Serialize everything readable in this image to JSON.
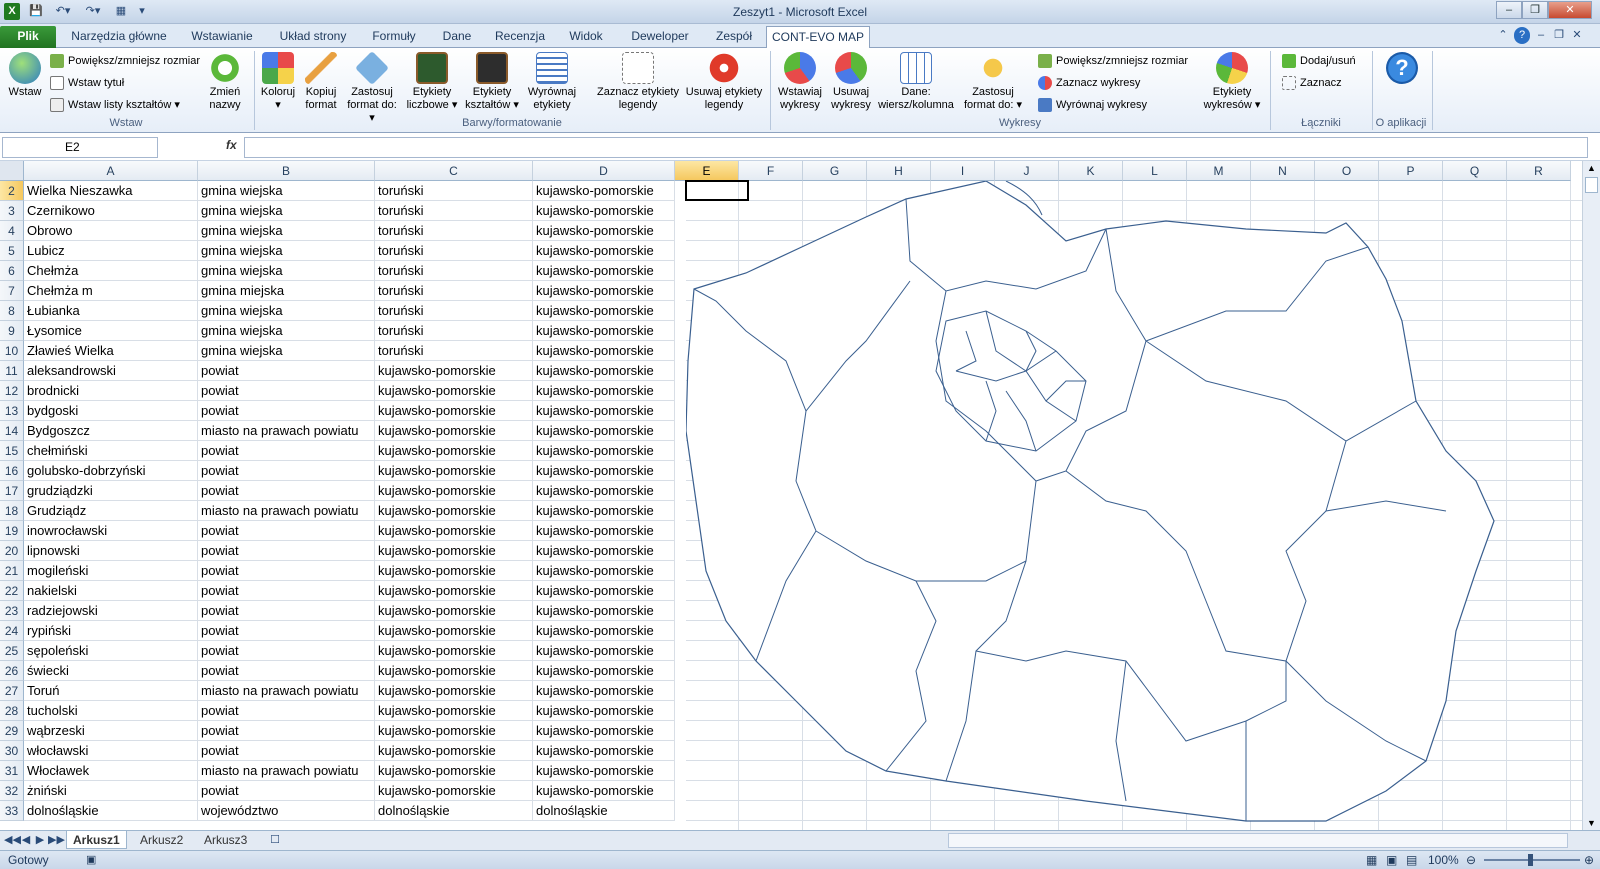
{
  "window": {
    "title": "Zeszyt1 - Microsoft Excel"
  },
  "quick_access": {
    "save_icon": "save-icon",
    "undo_icon": "undo-icon",
    "redo_icon": "redo-icon"
  },
  "tabs": [
    "Plik",
    "Narzędzia główne",
    "Wstawianie",
    "Układ strony",
    "Formuły",
    "Dane",
    "Recenzja",
    "Widok",
    "Deweloper",
    "Zespół",
    "CONT-EVO MAP"
  ],
  "ribbon": {
    "insert_label": "Wstaw",
    "resize_label": "Powiększ/zmniejsz rozmiar",
    "insert_title_label": "Wstaw tytuł",
    "insert_shape_lists_label": "Wstaw listy kształtów",
    "rename_label": "Zmień nazwy",
    "group_wstaw": "Wstaw",
    "color_label": "Koloruj",
    "copy_format_label": "Kopiuj format",
    "apply_format_label": "Zastosuj format do:",
    "number_labels_label": "Etykiety liczbowe",
    "shape_labels_label": "Etykiety kształtów",
    "align_labels_label": "Wyrównaj etykiety",
    "mark_legend_labels_label": "Zaznacz etykiety legendy",
    "remove_legend_labels_label": "Usuwaj etykiety legendy",
    "group_colors": "Barwy/formatowanie",
    "insert_charts_label": "Wstawiaj wykresy",
    "remove_charts_label": "Usuwaj wykresy",
    "data_rowcol_label": "Dane: wiersz/kolumna",
    "apply_format2_label": "Zastosuj format do:",
    "resize2_label": "Powiększ/zmniejsz rozmiar",
    "mark_charts_label": "Zaznacz wykresy",
    "align_charts_label": "Wyrównaj wykresy",
    "chart_labels_label": "Etykiety wykresów",
    "group_charts": "Wykresy",
    "add_remove_label": "Dodaj/usuń",
    "select_label": "Zaznacz",
    "group_connectors": "Łączniki",
    "group_about": "O aplikacji"
  },
  "formula_bar": {
    "name_box": "E2",
    "fx": "fx",
    "formula": ""
  },
  "columns": [
    "A",
    "B",
    "C",
    "D",
    "E",
    "F",
    "G",
    "H",
    "I",
    "J",
    "K",
    "L",
    "M",
    "N",
    "O",
    "P",
    "Q",
    "R"
  ],
  "rows": [
    {
      "n": "2",
      "a": "Wielka Nieszawka",
      "b": "gmina wiejska",
      "c": "toruński",
      "d": "kujawsko-pomorskie"
    },
    {
      "n": "3",
      "a": "Czernikowo",
      "b": "gmina wiejska",
      "c": "toruński",
      "d": "kujawsko-pomorskie"
    },
    {
      "n": "4",
      "a": "Obrowo",
      "b": "gmina wiejska",
      "c": "toruński",
      "d": "kujawsko-pomorskie"
    },
    {
      "n": "5",
      "a": "Lubicz",
      "b": "gmina wiejska",
      "c": "toruński",
      "d": "kujawsko-pomorskie"
    },
    {
      "n": "6",
      "a": "Chełmża",
      "b": "gmina wiejska",
      "c": "toruński",
      "d": "kujawsko-pomorskie"
    },
    {
      "n": "7",
      "a": "Chełmża m",
      "b": "gmina miejska",
      "c": "toruński",
      "d": "kujawsko-pomorskie"
    },
    {
      "n": "8",
      "a": "Łubianka",
      "b": "gmina wiejska",
      "c": "toruński",
      "d": "kujawsko-pomorskie"
    },
    {
      "n": "9",
      "a": "Łysomice",
      "b": "gmina wiejska",
      "c": "toruński",
      "d": "kujawsko-pomorskie"
    },
    {
      "n": "10",
      "a": "Zławieś Wielka",
      "b": "gmina wiejska",
      "c": "toruński",
      "d": "kujawsko-pomorskie"
    },
    {
      "n": "11",
      "a": "aleksandrowski",
      "b": "powiat",
      "c": "kujawsko-pomorskie",
      "d": "kujawsko-pomorskie"
    },
    {
      "n": "12",
      "a": "brodnicki",
      "b": "powiat",
      "c": "kujawsko-pomorskie",
      "d": "kujawsko-pomorskie"
    },
    {
      "n": "13",
      "a": "bydgoski",
      "b": "powiat",
      "c": "kujawsko-pomorskie",
      "d": "kujawsko-pomorskie"
    },
    {
      "n": "14",
      "a": "Bydgoszcz",
      "b": "miasto na prawach powiatu",
      "c": "kujawsko-pomorskie",
      "d": "kujawsko-pomorskie"
    },
    {
      "n": "15",
      "a": "chełmiński",
      "b": "powiat",
      "c": "kujawsko-pomorskie",
      "d": "kujawsko-pomorskie"
    },
    {
      "n": "16",
      "a": "golubsko-dobrzyński",
      "b": "powiat",
      "c": "kujawsko-pomorskie",
      "d": "kujawsko-pomorskie"
    },
    {
      "n": "17",
      "a": "grudziądzki",
      "b": "powiat",
      "c": "kujawsko-pomorskie",
      "d": "kujawsko-pomorskie"
    },
    {
      "n": "18",
      "a": "Grudziądz",
      "b": "miasto na prawach powiatu",
      "c": "kujawsko-pomorskie",
      "d": "kujawsko-pomorskie"
    },
    {
      "n": "19",
      "a": "inowrocławski",
      "b": "powiat",
      "c": "kujawsko-pomorskie",
      "d": "kujawsko-pomorskie"
    },
    {
      "n": "20",
      "a": "lipnowski",
      "b": "powiat",
      "c": "kujawsko-pomorskie",
      "d": "kujawsko-pomorskie"
    },
    {
      "n": "21",
      "a": "mogileński",
      "b": "powiat",
      "c": "kujawsko-pomorskie",
      "d": "kujawsko-pomorskie"
    },
    {
      "n": "22",
      "a": "nakielski",
      "b": "powiat",
      "c": "kujawsko-pomorskie",
      "d": "kujawsko-pomorskie"
    },
    {
      "n": "23",
      "a": "radziejowski",
      "b": "powiat",
      "c": "kujawsko-pomorskie",
      "d": "kujawsko-pomorskie"
    },
    {
      "n": "24",
      "a": "rypiński",
      "b": "powiat",
      "c": "kujawsko-pomorskie",
      "d": "kujawsko-pomorskie"
    },
    {
      "n": "25",
      "a": "sępoleński",
      "b": "powiat",
      "c": "kujawsko-pomorskie",
      "d": "kujawsko-pomorskie"
    },
    {
      "n": "26",
      "a": "świecki",
      "b": "powiat",
      "c": "kujawsko-pomorskie",
      "d": "kujawsko-pomorskie"
    },
    {
      "n": "27",
      "a": "Toruń",
      "b": "miasto na prawach powiatu",
      "c": "kujawsko-pomorskie",
      "d": "kujawsko-pomorskie"
    },
    {
      "n": "28",
      "a": "tucholski",
      "b": "powiat",
      "c": "kujawsko-pomorskie",
      "d": "kujawsko-pomorskie"
    },
    {
      "n": "29",
      "a": "wąbrzeski",
      "b": "powiat",
      "c": "kujawsko-pomorskie",
      "d": "kujawsko-pomorskie"
    },
    {
      "n": "30",
      "a": "włocławski",
      "b": "powiat",
      "c": "kujawsko-pomorskie",
      "d": "kujawsko-pomorskie"
    },
    {
      "n": "31",
      "a": "Włocławek",
      "b": "miasto na prawach powiatu",
      "c": "kujawsko-pomorskie",
      "d": "kujawsko-pomorskie"
    },
    {
      "n": "32",
      "a": "żniński",
      "b": "powiat",
      "c": "kujawsko-pomorskie",
      "d": "kujawsko-pomorskie"
    },
    {
      "n": "33",
      "a": "dolnośląskie",
      "b": "województwo",
      "c": "dolnośląskie",
      "d": "dolnośląskie"
    }
  ],
  "sheets": [
    "Arkusz1",
    "Arkusz2",
    "Arkusz3"
  ],
  "status": {
    "ready": "Gotowy",
    "zoom": "100%"
  },
  "colors": {
    "file_tab": "#2a862a",
    "header_bg": "#e4ebf3",
    "selected_header": "#f5c85f",
    "map_stroke": "#3a5f8f"
  }
}
